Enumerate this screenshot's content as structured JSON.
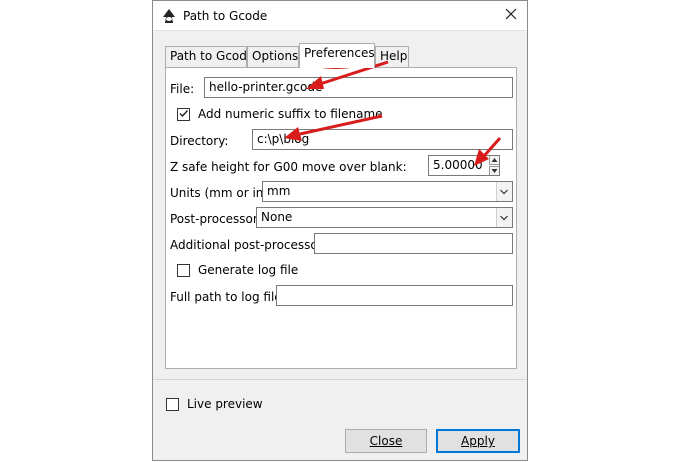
{
  "window": {
    "title": "Path to Gcode",
    "app_icon": "inkscape-icon",
    "close_icon": "close-icon"
  },
  "tabs": [
    {
      "label": "Path to Gcode",
      "active": false
    },
    {
      "label": "Options",
      "active": false
    },
    {
      "label": "Preferences",
      "active": true
    },
    {
      "label": "Help",
      "active": false
    }
  ],
  "form": {
    "file_label": "File:",
    "file_value": "hello-printer.gcode",
    "suffix_label": "Add numeric suffix to filename",
    "suffix_checked": true,
    "directory_label": "Directory:",
    "directory_value": "c:\\p\\blog",
    "zsafe_label": "Z safe height for G00 move over blank:",
    "zsafe_value": "5.00000",
    "units_label": "Units (mm or in):",
    "units_value": "mm",
    "post_label": "Post-processor:",
    "post_value": "None",
    "additional_post_label": "Additional post-processor:",
    "additional_post_value": "",
    "genlog_label": "Generate log file",
    "genlog_checked": false,
    "logpath_label": "Full path to log file:",
    "logpath_value": ""
  },
  "footer": {
    "live_preview_label": "Live preview",
    "live_preview_checked": false,
    "close_label": "Close",
    "apply_label": "Apply"
  },
  "annotations": {
    "color": "#d81b1b"
  }
}
